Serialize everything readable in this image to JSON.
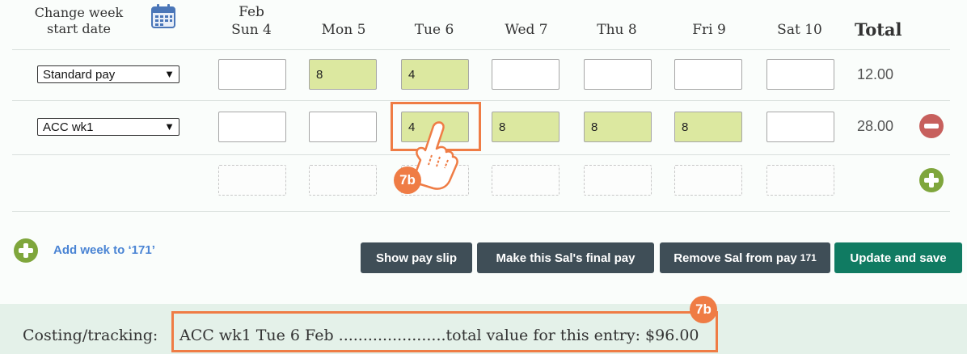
{
  "header": {
    "change_week_line1": "Change week",
    "change_week_line2": "start date",
    "days": [
      {
        "line1": "Feb",
        "line2": "Sun 4"
      },
      {
        "line1": "",
        "line2": "Mon 5"
      },
      {
        "line1": "",
        "line2": "Tue 6"
      },
      {
        "line1": "",
        "line2": "Wed 7"
      },
      {
        "line1": "",
        "line2": "Thu 8"
      },
      {
        "line1": "",
        "line2": "Fri 9"
      },
      {
        "line1": "",
        "line2": "Sat 10"
      }
    ],
    "total_label": "Total"
  },
  "rows": [
    {
      "pay_type": "Standard pay",
      "values": [
        "",
        "8",
        "4",
        "",
        "",
        "",
        ""
      ],
      "total": "12.00"
    },
    {
      "pay_type": "ACC wk1",
      "values": [
        "",
        "",
        "4",
        "8",
        "8",
        "8",
        ""
      ],
      "total": "28.00"
    }
  ],
  "add_week_label": "Add week to ‘171’",
  "buttons": {
    "show_pay_slip": "Show pay slip",
    "final_pay": "Make this Sal's final pay",
    "remove_sal": "Remove Sal from pay",
    "remove_sal_suffix": "171",
    "update_save": "Update and save"
  },
  "badge_label": "7b",
  "costing": {
    "prefix": "Costing/tracking:",
    "entry": "ACC wk1 Tue 6 Feb ......................total value for this entry: $96.00"
  },
  "colors": {
    "filled_cell": "#dce8a0",
    "accent_orange": "#ef7c45",
    "save_green": "#107b62",
    "gray_button": "#3f4e57",
    "plus_green": "#7fa63c",
    "minus_red": "#c7605d"
  },
  "icons": [
    "calendar-icon",
    "minus-circle-icon",
    "plus-circle-icon",
    "pointer-hand-icon"
  ]
}
